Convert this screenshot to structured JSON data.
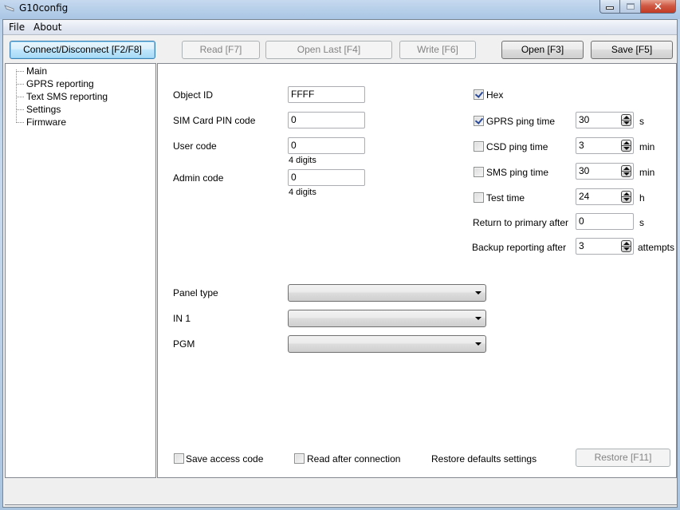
{
  "window": {
    "title": "G10config",
    "controls": {
      "minimize": "minimize",
      "maximize": "maximize",
      "close": "×"
    }
  },
  "menu": {
    "items": [
      "File",
      "About"
    ]
  },
  "toolbar": {
    "connect": "Connect/Disconnect [F2/F8]",
    "read": "Read [F7]",
    "open_last": "Open Last [F4]",
    "write": "Write [F6]",
    "open": "Open [F3]",
    "save": "Save [F5]"
  },
  "tree": {
    "items": [
      "Main",
      "GPRS reporting",
      "Text SMS reporting",
      "Settings",
      "Firmware"
    ]
  },
  "main": {
    "object_id": {
      "label": "Object ID",
      "value": "FFFF"
    },
    "sim_pin": {
      "label": "SIM Card PIN code",
      "value": "0"
    },
    "user_code": {
      "label": "User code",
      "value": "0",
      "hint": "4 digits"
    },
    "admin_code": {
      "label": "Admin code",
      "value": "0",
      "hint": "4 digits"
    },
    "hex": {
      "label": "Hex",
      "checked": true
    },
    "gprs_ping": {
      "label": "GPRS ping time",
      "checked": true,
      "value": "30",
      "unit": "s"
    },
    "csd_ping": {
      "label": "CSD ping time",
      "checked": false,
      "value": "3",
      "unit": "min"
    },
    "sms_ping": {
      "label": "SMS ping time",
      "checked": false,
      "value": "30",
      "unit": "min"
    },
    "test_time": {
      "label": "Test time",
      "checked": false,
      "value": "24",
      "unit": "h"
    },
    "return_primary": {
      "label": "Return to primary after",
      "value": "0",
      "unit": "s"
    },
    "backup_reporting": {
      "label": "Backup reporting after",
      "value": "3",
      "unit": "attempts"
    },
    "panel_type": {
      "label": "Panel type",
      "value": ""
    },
    "in1": {
      "label": "IN 1",
      "value": ""
    },
    "pgm": {
      "label": "PGM",
      "value": ""
    },
    "save_access_code": {
      "label": "Save access code",
      "checked": false
    },
    "read_after_connection": {
      "label": "Read after connection",
      "checked": false
    },
    "restore_label": "Restore defaults settings",
    "restore_button": "Restore [F11]"
  },
  "statusbar": {
    "text": ""
  }
}
